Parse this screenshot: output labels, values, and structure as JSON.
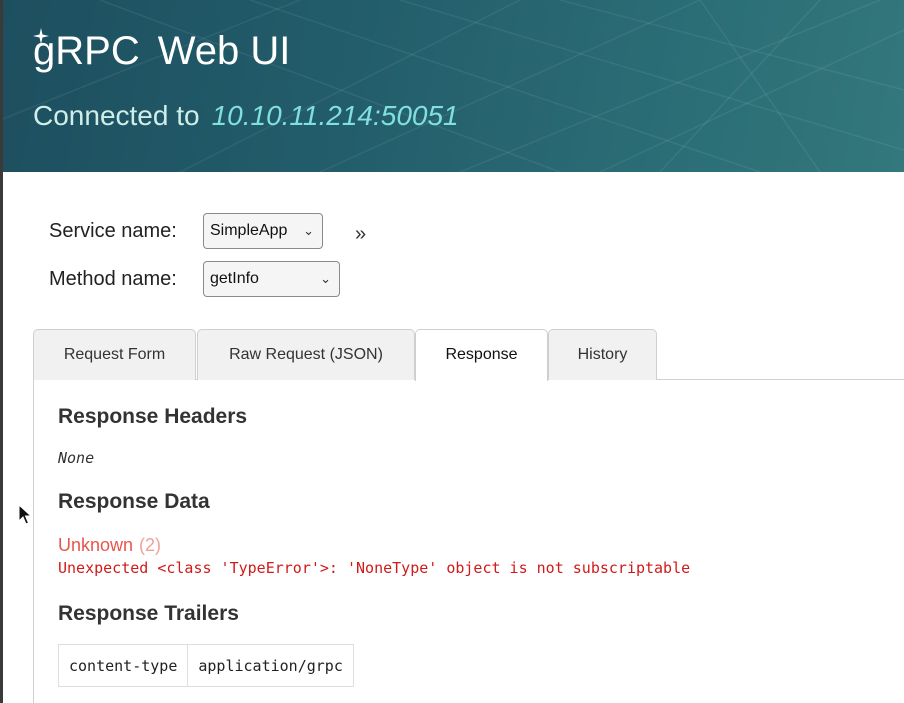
{
  "header": {
    "brand_g": "g",
    "brand_rest": "RPC",
    "brand_suffix": "Web UI",
    "connected_label": "Connected to",
    "address": "10.10.11.214:50051"
  },
  "form": {
    "service_label": "Service name:",
    "service_value": "SimpleApp",
    "method_label": "Method name:",
    "method_value": "getInfo",
    "expand_glyph": "»"
  },
  "tabs": [
    {
      "label": "Request Form",
      "active": false
    },
    {
      "label": "Raw Request (JSON)",
      "active": false
    },
    {
      "label": "Response",
      "active": true
    },
    {
      "label": "History",
      "active": false
    }
  ],
  "response": {
    "headers_title": "Response Headers",
    "headers_value": "None",
    "data_title": "Response Data",
    "error_status": "Unknown",
    "error_code": "(2)",
    "error_message": "Unexpected <class 'TypeError'>: 'NoneType' object is not subscriptable",
    "trailers_title": "Response Trailers",
    "trailers": [
      {
        "key": "content-type",
        "value": "application/grpc"
      }
    ]
  },
  "colors": {
    "header_bg": "#235d6b",
    "address": "#7fe0dd",
    "error_status": "#e8554e",
    "error_message": "#d11a1a"
  }
}
